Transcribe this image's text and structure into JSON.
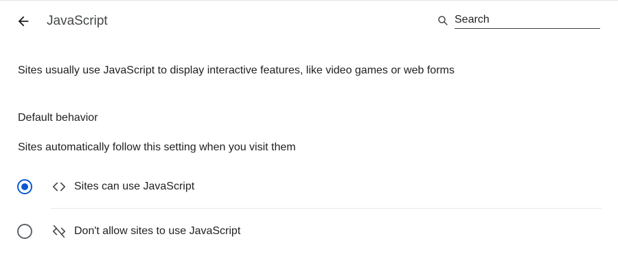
{
  "header": {
    "title": "JavaScript",
    "back_icon": "arrow-back-icon",
    "search_icon": "search-icon",
    "search_placeholder": "Search",
    "search_value": ""
  },
  "main": {
    "description": "Sites usually use JavaScript to display interactive features, like video games or web forms",
    "default_behavior": {
      "heading": "Default behavior",
      "subtext": "Sites automatically follow this setting when you visit them",
      "options": [
        {
          "label": "Sites can use JavaScript",
          "icon": "code-icon",
          "selected": true
        },
        {
          "label": "Don't allow sites to use JavaScript",
          "icon": "code-off-icon",
          "selected": false
        }
      ]
    }
  },
  "colors": {
    "accent": "#0b57d0",
    "text": "#1f1f1f",
    "title": "#444746",
    "divider": "#e7e7e7"
  }
}
